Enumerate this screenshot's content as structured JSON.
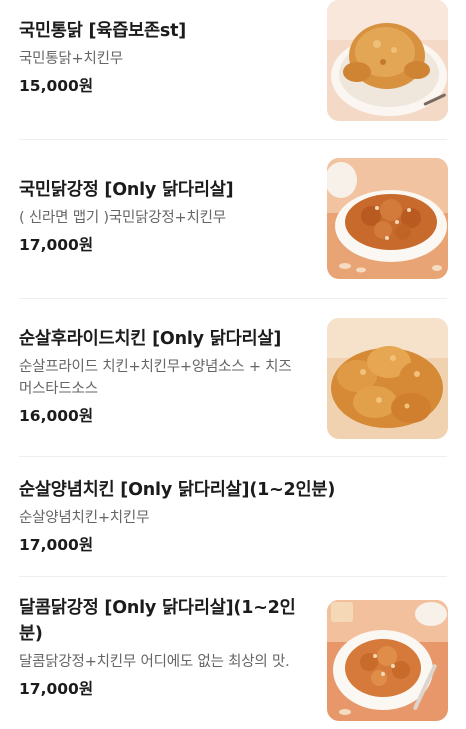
{
  "menu": {
    "items": [
      {
        "name": "국민통닭 [육즙보존st]",
        "desc": "국민통닭+치킨무",
        "price": "15,000원",
        "image_icon": "whole-roast-chicken-icon"
      },
      {
        "name": "국민닭강정 [Only 닭다리살]",
        "desc": "( 신라면 맵기 )국민닭강정+치킨무",
        "price": "17,000원",
        "image_icon": "glazed-chicken-bowl-icon"
      },
      {
        "name": "순살후라이드치킨 [Only 닭다리살]",
        "desc": "순살프라이드 치킨+치킨무+양념소스 + 치즈머스타드소스",
        "price": "16,000원",
        "image_icon": "fried-chicken-pile-icon"
      },
      {
        "name": "순살양념치킨 [Only 닭다리살](1~2인분)",
        "desc": "순살양념치킨+치킨무",
        "price": "17,000원"
      },
      {
        "name": "달콤닭강정 [Only 닭다리살](1~2인분)",
        "desc": "달콤닭강정+치킨무 어디에도 없는 최상의 맛.",
        "price": "17,000원",
        "image_icon": "sweet-chicken-plate-icon"
      }
    ]
  },
  "colors": {
    "text_primary": "#1b1b1b",
    "text_secondary": "#666666",
    "divider": "#efefef"
  }
}
